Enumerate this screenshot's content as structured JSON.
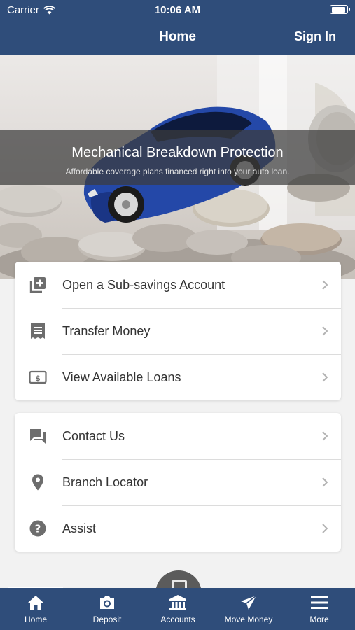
{
  "status_bar": {
    "carrier": "Carrier",
    "time": "10:06 AM",
    "battery_level": 0.95
  },
  "nav": {
    "title": "Home",
    "sign_in_label": "Sign In"
  },
  "banner": {
    "title": "Mechanical Breakdown Protection",
    "subtitle": "Affordable coverage plans financed right into your auto loan."
  },
  "menu_group_1": [
    {
      "label": "Open a Sub-savings Account",
      "icon": "add-account-icon"
    },
    {
      "label": "Transfer Money",
      "icon": "receipt-icon"
    },
    {
      "label": "View Available Loans",
      "icon": "dollar-bill-icon"
    }
  ],
  "menu_group_2": [
    {
      "label": "Contact Us",
      "icon": "chat-icon"
    },
    {
      "label": "Branch Locator",
      "icon": "location-pin-icon"
    },
    {
      "label": "Assist",
      "icon": "help-icon"
    }
  ],
  "tabs": [
    {
      "label": "Home",
      "icon": "home-icon"
    },
    {
      "label": "Deposit",
      "icon": "camera-icon"
    },
    {
      "label": "Accounts",
      "icon": "bank-icon"
    },
    {
      "label": "Move Money",
      "icon": "send-icon"
    },
    {
      "label": "More",
      "icon": "menu-icon"
    }
  ],
  "colors": {
    "nav_bg": "#2f4d7a",
    "icon_gray": "#6d6d6d",
    "car_blue": "#2448a8"
  }
}
